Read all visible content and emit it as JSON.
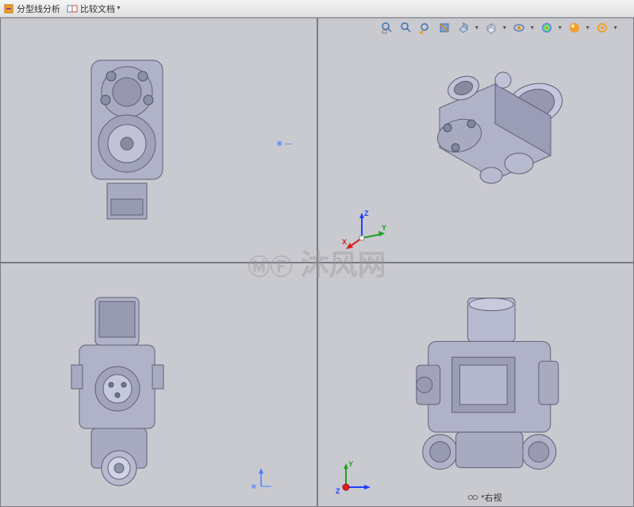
{
  "toolbar": {
    "item1_label": "分型线分析",
    "item2_label": "比较文档"
  },
  "hud_icons": {
    "zoom_fit": "zoom-fit",
    "zoom_area": "zoom-area",
    "prev_view": "previous-view",
    "section": "section-view",
    "view_orient": "view-orientation",
    "display_style": "display-style",
    "hide_show": "hide-show",
    "appearance": "edit-appearance",
    "scene": "apply-scene",
    "view_settings": "view-settings"
  },
  "triads": {
    "iso": {
      "x": "X",
      "y": "Y",
      "z": "Z"
    },
    "right": {
      "x": "Y",
      "y": "Z"
    }
  },
  "view_label": "*右视",
  "watermark_text": "沐风网",
  "plane_indicator": "⋇"
}
